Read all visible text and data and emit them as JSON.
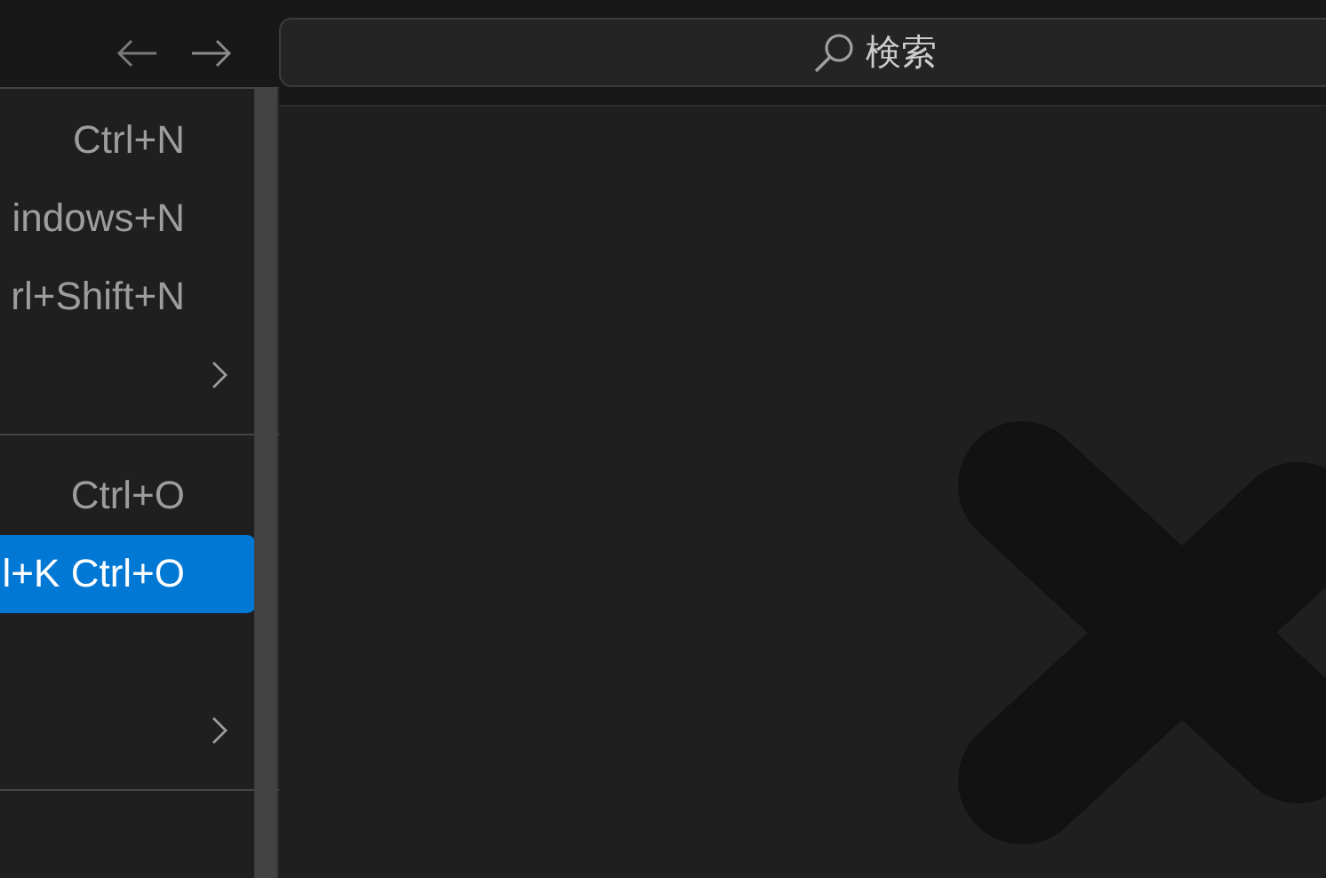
{
  "title_bar": {
    "search": {
      "placeholder": "検索"
    }
  },
  "menu": {
    "items": [
      {
        "kind": "item",
        "shortcut": "Ctrl+N",
        "selected": false
      },
      {
        "kind": "item",
        "shortcut": "indows+N",
        "selected": false
      },
      {
        "kind": "item",
        "shortcut": "rl+Shift+N",
        "selected": false
      },
      {
        "kind": "submenu",
        "selected": false
      },
      {
        "kind": "separator"
      },
      {
        "kind": "item",
        "shortcut": "Ctrl+O",
        "selected": false
      },
      {
        "kind": "item",
        "shortcut": "l+K Ctrl+O",
        "selected": true
      },
      {
        "kind": "blank"
      },
      {
        "kind": "submenu",
        "selected": false
      },
      {
        "kind": "separator"
      }
    ]
  }
}
